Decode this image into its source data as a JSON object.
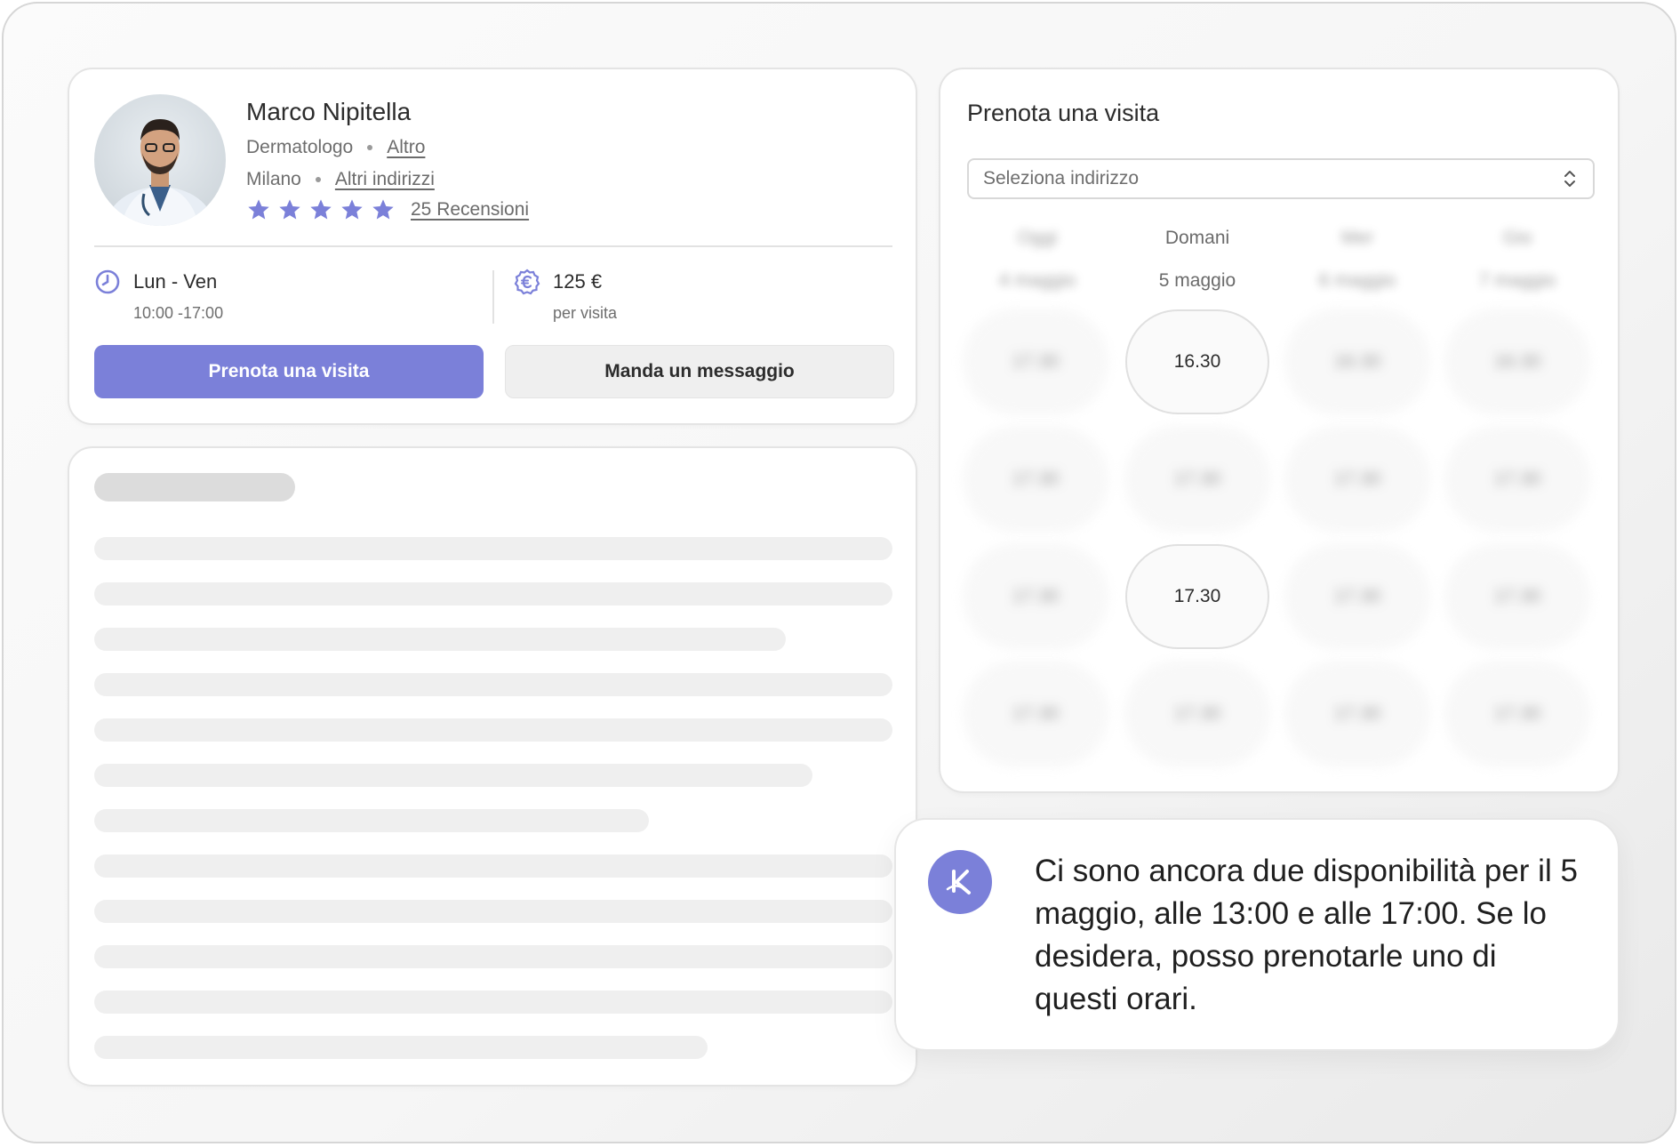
{
  "profile": {
    "name": "Marco Nipitella",
    "specialty": "Dermatologo",
    "specialty_link": "Altro",
    "city": "Milano",
    "city_link": "Altri indirizzi",
    "rating_stars": 5,
    "reviews_label": "25 Recensioni",
    "hours_days": "Lun - Ven",
    "hours_time": "10:00 -17:00",
    "price": "125 €",
    "price_unit": "per visita",
    "book_button": "Prenota una visita",
    "message_button": "Manda un messaggio"
  },
  "booking": {
    "title": "Prenota una visita",
    "select_placeholder": "Seleziona indirizzo",
    "days": [
      {
        "name": "Oggi",
        "date": "4 maggio",
        "blurred": true
      },
      {
        "name": "Domani",
        "date": "5 maggio",
        "blurred": false
      },
      {
        "name": "Mer",
        "date": "6 maggio",
        "blurred": true
      },
      {
        "name": "Gio",
        "date": "7 maggio",
        "blurred": true
      }
    ],
    "slots": [
      [
        "17.30",
        "16.30",
        "16.30",
        "16.30"
      ],
      [
        "17.30",
        "17.30",
        "17.30",
        "17.30"
      ],
      [
        "17.30",
        "17.30",
        "17.30",
        "17.30"
      ],
      [
        "17.30",
        "17.30",
        "17.30",
        "17.30"
      ]
    ],
    "visible_slots": [
      [
        0,
        1
      ],
      [
        2,
        1
      ]
    ]
  },
  "chat": {
    "message": "Ci sono ancora due disponibilità per il 5 maggio, alle 13:00 e alle 17:00. Se lo desidera, posso prenotarle uno di questi orari."
  },
  "colors": {
    "accent": "#7b80d9",
    "star": "#7b80d9",
    "skeleton_title": "#dcdcdc",
    "skeleton_line": "#efefef"
  },
  "icons": {
    "hours": "clock-icon",
    "price": "euro-badge-icon",
    "select": "chevron-up-down-icon",
    "assistant": "assistant-logo-icon"
  }
}
